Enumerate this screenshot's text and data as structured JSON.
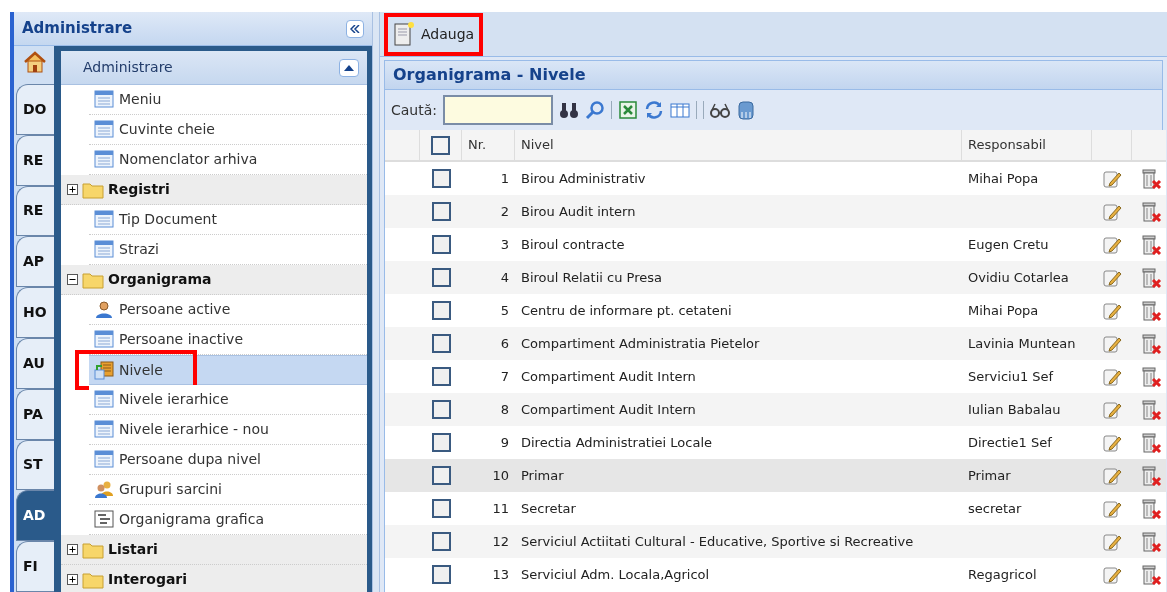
{
  "sidebar": {
    "title": "Administrare",
    "tabs": [
      {
        "kind": "home",
        "selected": false
      },
      {
        "label": "DO",
        "selected": false
      },
      {
        "label": "RE",
        "selected": false
      },
      {
        "label": "RE",
        "selected": false
      },
      {
        "label": "AP",
        "selected": false
      },
      {
        "label": "HO",
        "selected": false
      },
      {
        "label": "AU",
        "selected": false
      },
      {
        "label": "PA",
        "selected": false
      },
      {
        "label": "ST",
        "selected": false
      },
      {
        "label": "AD",
        "selected": true
      },
      {
        "label": "FI",
        "selected": false
      }
    ],
    "section": {
      "title": "Administrare",
      "expanded": true
    },
    "tree": [
      {
        "kind": "form",
        "label": "Meniu",
        "selected": false,
        "highlighted": false
      },
      {
        "kind": "form",
        "label": "Cuvinte cheie",
        "selected": false,
        "highlighted": false
      },
      {
        "kind": "form",
        "label": "Nomenclator arhiva",
        "selected": false,
        "highlighted": false
      },
      {
        "kind": "folder",
        "label": "Registri",
        "expanded": false,
        "children": [
          {
            "kind": "form",
            "label": "Tip Document",
            "selected": false,
            "highlighted": false
          },
          {
            "kind": "form",
            "label": "Strazi",
            "selected": false,
            "highlighted": false
          }
        ]
      },
      {
        "kind": "folder",
        "label": "Organigrama",
        "expanded": true,
        "children": [
          {
            "kind": "person",
            "label": "Persoane active",
            "selected": false,
            "highlighted": false
          },
          {
            "kind": "form",
            "label": "Persoane inactive",
            "selected": false,
            "highlighted": false
          },
          {
            "kind": "levels",
            "label": "Nivele",
            "selected": true,
            "highlighted": true
          },
          {
            "kind": "form",
            "label": "Nivele ierarhice",
            "selected": false,
            "highlighted": false
          },
          {
            "kind": "form",
            "label": "Nivele ierarhice - nou",
            "selected": false,
            "highlighted": false
          },
          {
            "kind": "form",
            "label": "Persoane dupa nivel",
            "selected": false,
            "highlighted": false
          },
          {
            "kind": "group",
            "label": "Grupuri sarcini",
            "selected": false,
            "highlighted": false
          },
          {
            "kind": "chart",
            "label": "Organigrama grafica",
            "selected": false,
            "highlighted": false
          }
        ]
      },
      {
        "kind": "folder",
        "label": "Listari",
        "expanded": false
      },
      {
        "kind": "folder",
        "label": "Interogari",
        "expanded": false
      }
    ]
  },
  "toolbar": {
    "add_button": {
      "label": "Adauga",
      "highlighted": true
    }
  },
  "panel": {
    "title": "Organigrama - Nivele",
    "search": {
      "label": "Caută:"
    },
    "table": {
      "columns": [
        "Nr.",
        "Nivel",
        "Responsabil"
      ],
      "select_all": false,
      "rows": [
        {
          "nr": "1",
          "nivel": "Birou Administrativ",
          "responsabil": "Mihai Popa",
          "checked": false,
          "hovered": false
        },
        {
          "nr": "2",
          "nivel": "Birou Audit intern",
          "responsabil": "",
          "checked": false,
          "hovered": false
        },
        {
          "nr": "3",
          "nivel": "Biroul contracte",
          "responsabil": "Eugen Cretu",
          "checked": false,
          "hovered": false
        },
        {
          "nr": "4",
          "nivel": "Biroul Relatii cu Presa",
          "responsabil": "Ovidiu Cotarlea",
          "checked": false,
          "hovered": false
        },
        {
          "nr": "5",
          "nivel": "Centru de informare pt. cetateni",
          "responsabil": "Mihai Popa",
          "checked": false,
          "hovered": false
        },
        {
          "nr": "6",
          "nivel": "Compartiment Administratia Pietelor",
          "responsabil": "Lavinia Muntean",
          "checked": false,
          "hovered": false
        },
        {
          "nr": "7",
          "nivel": "Compartiment Audit Intern",
          "responsabil": "Serviciu1 Sef",
          "checked": false,
          "hovered": false
        },
        {
          "nr": "8",
          "nivel": "Compartiment Audit Intern",
          "responsabil": "Iulian Babalau",
          "checked": false,
          "hovered": false
        },
        {
          "nr": "9",
          "nivel": "Directia Administratiei Locale",
          "responsabil": "Directie1 Sef",
          "checked": false,
          "hovered": false
        },
        {
          "nr": "10",
          "nivel": "Primar",
          "responsabil": "Primar",
          "checked": false,
          "hovered": true
        },
        {
          "nr": "11",
          "nivel": "Secretar",
          "responsabil": "secretar",
          "checked": false,
          "hovered": false
        },
        {
          "nr": "12",
          "nivel": "Serviciul Actiitati Cultural - Educative, Sportive si Recreative",
          "responsabil": "",
          "checked": false,
          "hovered": false
        },
        {
          "nr": "13",
          "nivel": "Serviciul Adm. Locala,Agricol",
          "responsabil": "Regagricol",
          "checked": false,
          "hovered": false
        }
      ]
    }
  }
}
